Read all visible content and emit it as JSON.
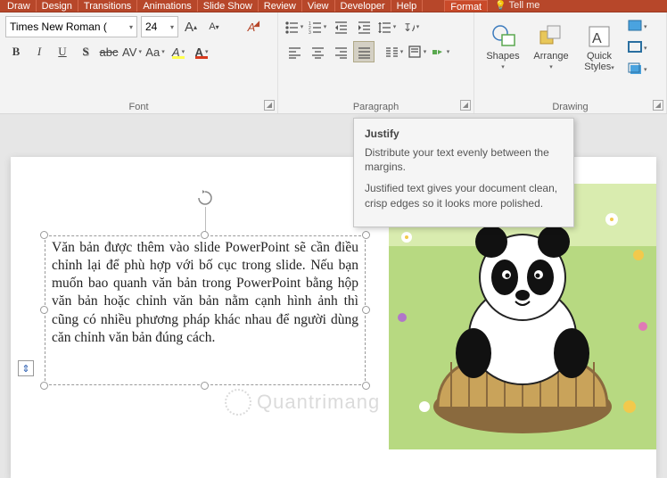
{
  "tabs": [
    "Draw",
    "Design",
    "Transitions",
    "Animations",
    "Slide Show",
    "Review",
    "View",
    "Developer",
    "Help"
  ],
  "format_tab": "Format",
  "tellme": "Tell me",
  "font": {
    "name": "Times New Roman (",
    "size": "24",
    "group_label": "Font",
    "buttons": {
      "grow": "A",
      "shrink": "A",
      "clear": "A",
      "bold": "B",
      "italic": "I",
      "underline": "U",
      "shadow": "S",
      "strike": "abc",
      "spacing": "AV",
      "case": "Aa",
      "highlight": "A",
      "fontcolor": "A"
    },
    "highlight_color": "#ffff4d",
    "fontcolor_color": "#d83a1e"
  },
  "paragraph": {
    "group_label": "Paragraph"
  },
  "drawing": {
    "group_label": "Drawing",
    "shapes": "Shapes",
    "arrange": "Arrange",
    "quick": "Quick",
    "styles": "Styles"
  },
  "tooltip": {
    "title": "Justify",
    "p1": "Distribute your text evenly between the margins.",
    "p2": "Justified text gives your document clean, crisp edges so it looks more polished."
  },
  "textbox": "Văn bản được thêm vào slide PowerPoint sẽ cần điều chỉnh lại để phù hợp với bố cục trong slide. Nếu bạn muốn bao quanh văn bản trong PowerPoint bằng hộp văn bản hoặc chỉnh văn bản nằm cạnh hình ảnh thì cũng có nhiều phương pháp khác nhau để người dùng căn chỉnh văn bản đúng cách.",
  "watermark": "Quantrimang"
}
